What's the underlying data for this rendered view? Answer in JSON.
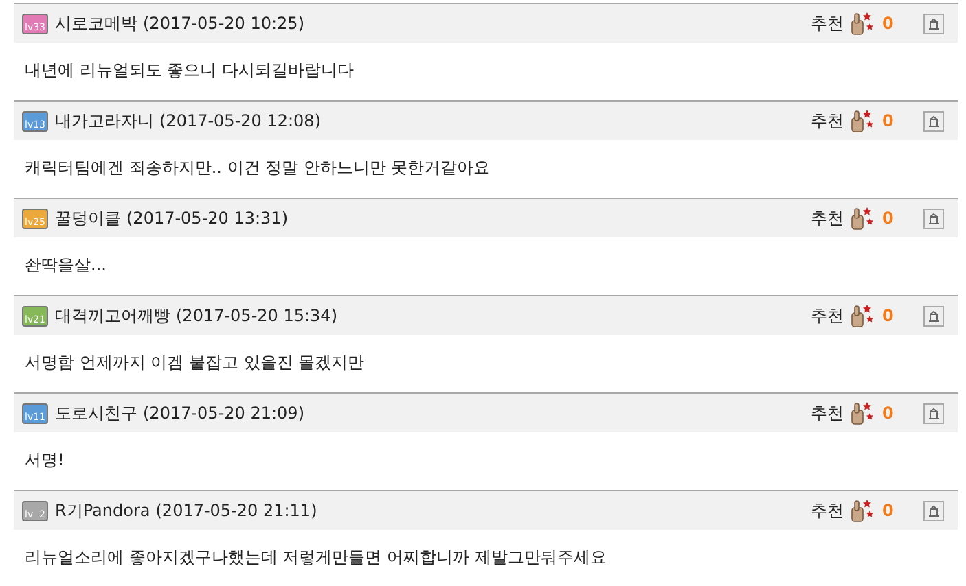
{
  "comments": [
    {
      "badge": {
        "label": "lv",
        "level": "33",
        "color": "#e27bb5"
      },
      "author": "시로코메박",
      "time": "(2017-05-20 10:25)",
      "recommend_label": "추천",
      "recommend_count": "0",
      "body": "내년에 리뉴얼되도 좋으니 다시되길바랍니다"
    },
    {
      "badge": {
        "label": "lv",
        "level": "13",
        "color": "#5a9bd8"
      },
      "author": "내가고라자니",
      "time": "(2017-05-20 12:08)",
      "recommend_label": "추천",
      "recommend_count": "0",
      "body": "캐릭터팀에겐 죄송하지만.. 이건 정말 안하느니만 못한거같아요"
    },
    {
      "badge": {
        "label": "lv",
        "level": "25",
        "color": "#eaa93a"
      },
      "author": "꿀덩이클",
      "time": "(2017-05-20 13:31)",
      "recommend_label": "추천",
      "recommend_count": "0",
      "body": "솬딱을살..."
    },
    {
      "badge": {
        "label": "lv",
        "level": "21",
        "color": "#86b85a"
      },
      "author": "대격끼고어깨빵",
      "time": "(2017-05-20 15:34)",
      "recommend_label": "추천",
      "recommend_count": "0",
      "body": "서명함 언제까지 이겜 붙잡고 있을진 몰겠지만"
    },
    {
      "badge": {
        "label": "lv",
        "level": "11",
        "color": "#5a9bd8"
      },
      "author": "도로시친구",
      "time": "(2017-05-20 21:09)",
      "recommend_label": "추천",
      "recommend_count": "0",
      "body": "서명!"
    },
    {
      "badge": {
        "label": "lv",
        "level": "2",
        "color": "#a8a8a8"
      },
      "author": "R기Pandora",
      "time": "(2017-05-20 21:11)",
      "recommend_label": "추천",
      "recommend_count": "0",
      "body": "리뉴얼소리에 좋아지겠구나했는데 저렇게만들면 어찌합니까 제발그만둬주세요"
    }
  ]
}
